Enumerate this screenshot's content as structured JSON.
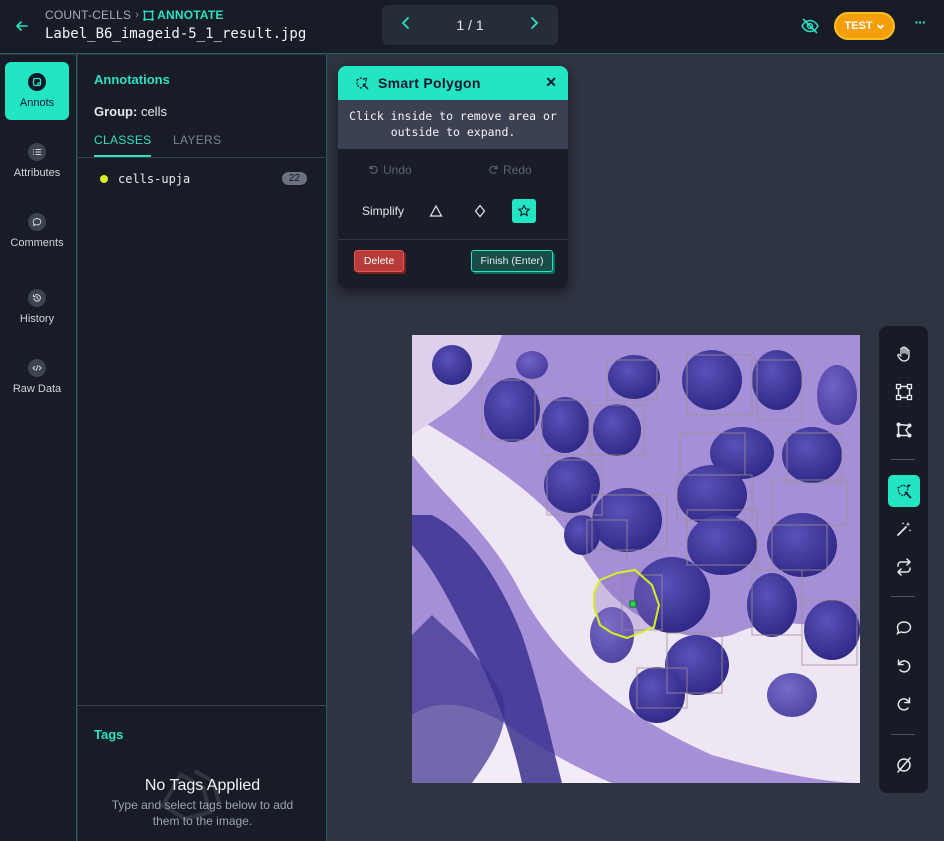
{
  "header": {
    "project": "COUNT-CELLS",
    "mode": "ANNOTATE",
    "filename": "Label_B6_imageid-5_1_result.jpg",
    "page_counter": "1 / 1",
    "test_label": "TEST",
    "more": "···",
    "accent_color": "#22e6c3",
    "test_color": "#f59e0b"
  },
  "leftnav": {
    "items": [
      {
        "label": "Annots",
        "icon": "annotations-icon",
        "active": true
      },
      {
        "label": "Attributes",
        "icon": "list-icon"
      },
      {
        "label": "Comments",
        "icon": "comment-icon"
      },
      {
        "label": "History",
        "icon": "history-icon"
      },
      {
        "label": "Raw Data",
        "icon": "code-icon"
      }
    ]
  },
  "panel": {
    "title": "Annotations",
    "group_label": "Group:",
    "group_value": "cells",
    "tabs": [
      "CLASSES",
      "LAYERS"
    ],
    "classes": [
      {
        "name": "cells-upja",
        "count": "22",
        "color": "#d4f020"
      }
    ],
    "tags_title": "Tags",
    "no_tags": "No Tags Applied",
    "no_tags_sub": "Type and select tags below to add them to the image."
  },
  "smart_polygon": {
    "title": "Smart Polygon",
    "close": "✕",
    "instruction": "Click inside to remove area or outside to expand.",
    "undo": "Undo",
    "redo": "Redo",
    "simplify_label": "Simplify",
    "delete_label": "Delete",
    "finish_label": "Finish (Enter)"
  },
  "toolbar": {
    "tools": [
      "hand-icon",
      "bounding-box-icon",
      "polygon-icon",
      "smart-polygon-icon",
      "magic-wand-icon",
      "repeat-icon",
      "comment-icon",
      "undo-icon",
      "redo-icon",
      "hide-annotations-icon"
    ],
    "active_tool": "smart-polygon-icon"
  }
}
